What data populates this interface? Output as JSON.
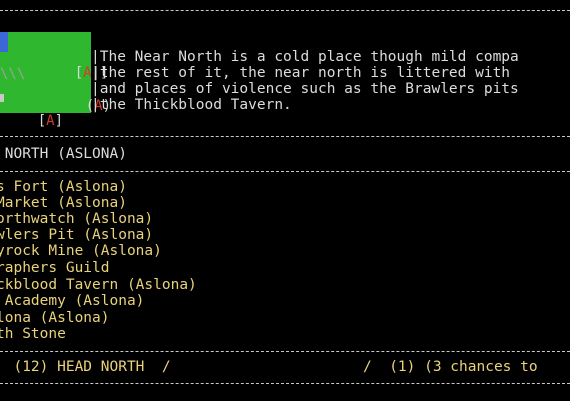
{
  "description_lines": [
    "|The Near North is a cold place though mild compa",
    "|the rest of it, the near north is littered with ",
    "|and places of violence such as the Brawlers pits",
    "|the Thickblood Tavern."
  ],
  "map_labels": {
    "row1_left": "[",
    "row1_mid": "A",
    "row1_right": "|]",
    "row2_hatch": "\\\\\\",
    "row2_paren_open": "(",
    "row2_mid": "A",
    "row2_paren_close": ")",
    "row3_left": "[",
    "row3_pipe": "|",
    "row3_open": "[",
    "row3_mid": "A",
    "row3_close": "]"
  },
  "area_header": " NORTH (ASLONA)",
  "locations": [
    "s Fort (Aslona)",
    "Market (Aslona)",
    "orthwatch (Aslona)",
    "wlers Pit (Aslona)",
    "yrock Mine (Aslona)",
    "raphers Guild",
    "ckblood Tavern (Aslona)",
    " Academy (Aslona)",
    "lona (Aslona)",
    "th Stone"
  ],
  "status_bar": {
    "left": "  (12) HEAD NORTH  /",
    "right": "/  (1) (3 chances to"
  },
  "colors": {
    "map_green": "#2fb82f",
    "map_water": "#3d66d8",
    "map_marker_red": "#d23a2a",
    "location_yellow": "#e8d27a"
  }
}
